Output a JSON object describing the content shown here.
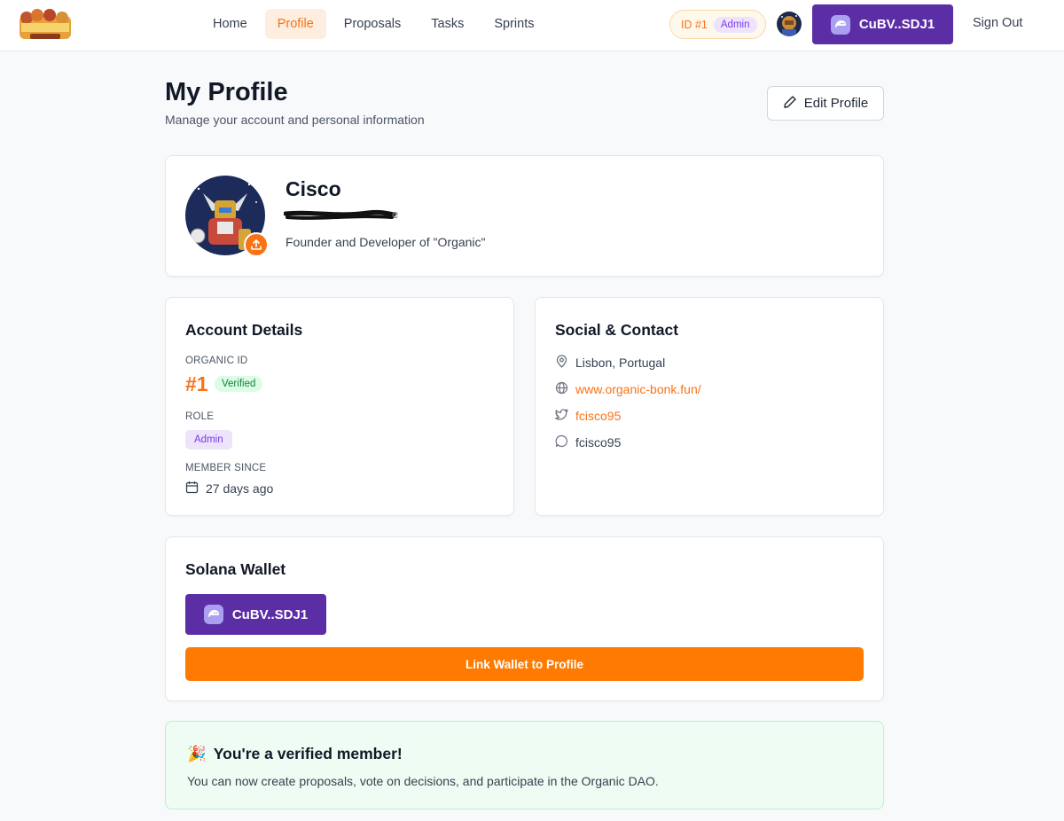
{
  "header": {
    "nav": [
      "Home",
      "Profile",
      "Proposals",
      "Tasks",
      "Sprints"
    ],
    "active_nav": "Profile",
    "id_label": "ID #1",
    "role_badge": "Admin",
    "wallet_label": "CuBV..SDJ1",
    "signout_label": "Sign Out"
  },
  "page": {
    "title": "My Profile",
    "subtitle": "Manage your account and personal information",
    "edit_label": "Edit Profile"
  },
  "profile": {
    "name": "Cisco",
    "email_visible_suffix": "e",
    "bio": "Founder and Developer of \"Organic\""
  },
  "account": {
    "title": "Account Details",
    "organic_id_label": "ORGANIC ID",
    "organic_id": "#1",
    "verified_label": "Verified",
    "role_label": "ROLE",
    "role": "Admin",
    "member_since_label": "MEMBER SINCE",
    "member_since": "27 days ago"
  },
  "social": {
    "title": "Social & Contact",
    "location": "Lisbon, Portugal",
    "website": "www.organic-bonk.fun/",
    "twitter": "fcisco95",
    "discord": "fcisco95"
  },
  "wallet": {
    "title": "Solana Wallet",
    "wallet_label": "CuBV..SDJ1",
    "link_label": "Link Wallet to Profile"
  },
  "banner": {
    "emoji": "🎉",
    "title": "You're a verified member!",
    "text": "You can now create proposals, vote on decisions, and participate in the Organic DAO."
  },
  "colors": {
    "accent": "#f97316",
    "wallet_purple": "#5b2ea6",
    "admin_purple": "#7c3aed",
    "verified_green": "#15803d"
  }
}
